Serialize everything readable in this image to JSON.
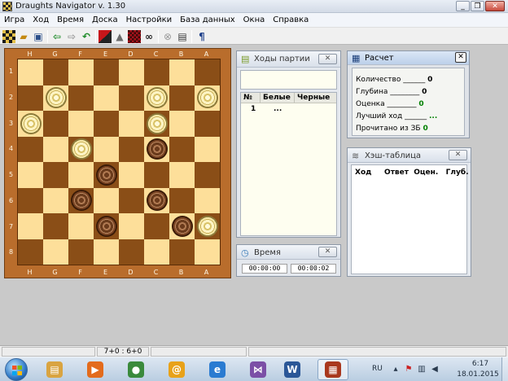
{
  "window": {
    "title": "Draughts Navigator v. 1.30",
    "minimize": "_",
    "maximize": "❐",
    "close": "✕"
  },
  "menu": [
    "Игра",
    "Ход",
    "Время",
    "Доска",
    "Настройки",
    "База данных",
    "Окна",
    "Справка"
  ],
  "toolbar_icons": [
    "new-game-icon",
    "open-icon",
    "save-icon",
    "back-icon",
    "forward-icon",
    "undo-icon",
    "board-flip-icon",
    "hand-icon",
    "grid-icon",
    "binoculars-icon",
    "stop-icon",
    "settings-icon",
    "help-book-icon"
  ],
  "board": {
    "files": [
      "H",
      "G",
      "F",
      "E",
      "D",
      "C",
      "B",
      "A"
    ],
    "ranks": [
      "1",
      "2",
      "3",
      "4",
      "5",
      "6",
      "7",
      "8"
    ],
    "white_piece_label": "white",
    "black_piece_label": "black",
    "rows": [
      "........",
      ".w...w.w",
      "w....w..",
      "..w..b..",
      "...b....",
      "..b..b..",
      "...b..bw",
      "........"
    ]
  },
  "moves_panel": {
    "title": "Ходы партии",
    "close": "✕",
    "columns": [
      "№",
      "Белые",
      "Черные"
    ],
    "rows": [
      {
        "num": "1",
        "white": "...",
        "black": ""
      }
    ]
  },
  "time_panel": {
    "title": "Время",
    "close": "✕",
    "white_time": "00:00:00",
    "black_time": "00:00:02"
  },
  "calc_panel": {
    "title": "Расчет",
    "close": "✕",
    "rows": [
      {
        "label": "Количество ______",
        "value": "0"
      },
      {
        "label": "Глубина ________",
        "value": "0"
      },
      {
        "label": "Оценка ________",
        "value": "0"
      },
      {
        "label": "Лучший ход ______",
        "value": "..."
      },
      {
        "label": "Прочитано из ЗБ",
        "value": "0"
      }
    ]
  },
  "hash_panel": {
    "title": "Хэш-таблица",
    "close": "✕",
    "columns": "Ход     Ответ  Оцен.   Глуб."
  },
  "status": {
    "score": "7+0 : 6+0"
  },
  "taskbar": {
    "apps": [
      {
        "name": "explorer",
        "glyph": "▤",
        "color": "#d9a441"
      },
      {
        "name": "media-player",
        "glyph": "▶",
        "color": "#e36b1c"
      },
      {
        "name": "chrome",
        "glyph": "●",
        "color": "#3a8a3c"
      },
      {
        "name": "mail-agent",
        "glyph": "@",
        "color": "#e8a21a"
      },
      {
        "name": "internet-explorer",
        "glyph": "e",
        "color": "#2a7bd1"
      },
      {
        "name": "visual-studio",
        "glyph": "⋈",
        "color": "#7b4fa6"
      },
      {
        "name": "word",
        "glyph": "W",
        "color": "#2b5797"
      },
      {
        "name": "draughts-navigator",
        "glyph": "▦",
        "color": "#a9381e"
      }
    ],
    "language": "RU",
    "time": "6:17",
    "date": "18.01.2015"
  }
}
